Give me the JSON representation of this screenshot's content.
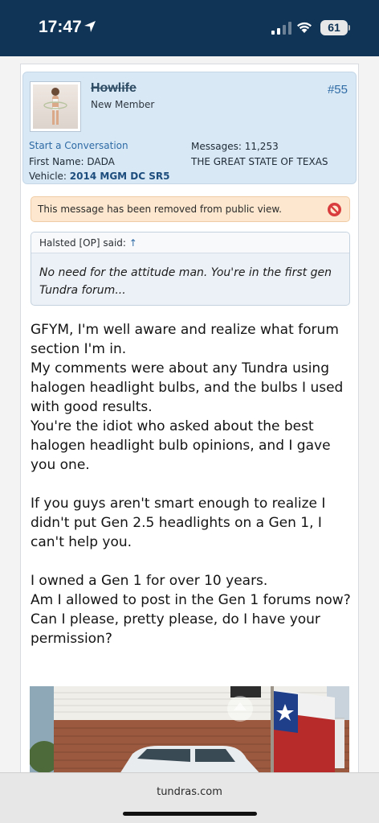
{
  "status_bar": {
    "time": "17:47",
    "battery": "61"
  },
  "post": {
    "username": "Howlife",
    "user_title": "New Member",
    "post_number": "#55",
    "start_conversation": "Start a Conversation",
    "messages_label": "Messages:",
    "messages_value": "11,253",
    "first_name_label": "First Name:",
    "first_name_value": "DADA",
    "location": "THE GREAT STATE OF TEXAS",
    "vehicle_label": "Vehicle:",
    "vehicle_value": "2014 MGM DC SR5"
  },
  "removed_notice": "This message has been removed from public view.",
  "quote": {
    "author": "Halsted [OP] said:",
    "arrow": "↑",
    "text": "No need for the attitude man. You're in the first gen Tundra forum..."
  },
  "message": {
    "lines": [
      "GFYM, I'm well aware and realize what forum section I'm in.",
      "My comments were about any Tundra using halogen headlight bulbs, and the bulbs I used with good results.",
      "You're the idiot who asked about the best halogen headlight bulb opinions, and I gave you one.",
      "",
      "If you guys aren't smart enough to realize I didn't put Gen 2.5 headlights on a Gen 1, I can't help you.",
      "",
      "I owned a Gen 1 for over 10 years.",
      "Am I allowed to post in the Gen 1 forums now?",
      "Can I please, pretty please, do I have your permission?"
    ]
  },
  "browser": {
    "url": "tundras.com"
  },
  "colors": {
    "status_bar_bg": "#0f3456",
    "user_panel_bg": "#d8e8f5",
    "link": "#2f6ba5",
    "notice_bg": "#fde8cf"
  },
  "icons": [
    "location-arrow-icon",
    "cellular-signal-icon",
    "wifi-icon",
    "battery-icon",
    "prohibited-icon"
  ]
}
